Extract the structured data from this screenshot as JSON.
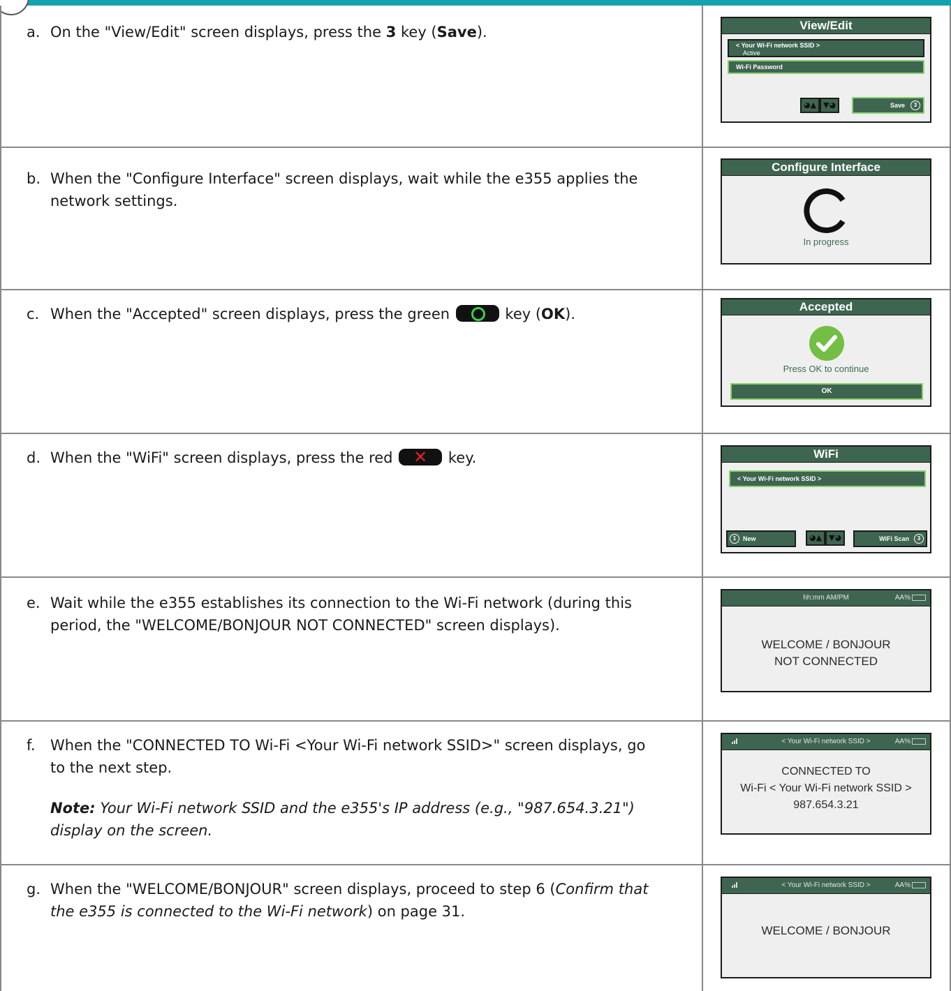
{
  "steps": [
    {
      "letter": "a.",
      "text_pre": "On the \"View/Edit\" screen displays, press the ",
      "key": "3",
      "text_mid": " key (",
      "key_label": "Save",
      "text_post": ")."
    },
    {
      "letter": "b.",
      "text": "When the \"Configure Interface\" screen displays, wait while the e355 applies the network settings."
    },
    {
      "letter": "c.",
      "text_pre": "When the \"Accepted\" screen displays, press the green ",
      "text_mid": " key (",
      "key_label": "OK",
      "text_post": ")."
    },
    {
      "letter": "d.",
      "text_pre": "When the \"WiFi\" screen displays, press the red ",
      "text_post": " key."
    },
    {
      "letter": "e.",
      "text": "Wait while the e355 establishes its connection to the Wi-Fi network (during this period, the \"WELCOME/BONJOUR NOT CONNECTED\" screen displays)."
    },
    {
      "letter": "f.",
      "text": "When the \"CONNECTED TO Wi-Fi <Your Wi-Fi network SSID>\" screen displays, go to the next step.",
      "note_label": "Note:",
      "note_text": " Your Wi-Fi network SSID and the e355's IP address (e.g., \"987.654.3.21\") display on the screen."
    },
    {
      "letter": "g.",
      "text_pre": "When the \"WELCOME/BONJOUR\" screen displays, proceed to step 6 (",
      "italic": "Confirm that the e355 is connected to the Wi-Fi network",
      "text_post": ") on page 31."
    }
  ],
  "screens": {
    "view_edit": {
      "title": "View/Edit",
      "ssid": "< Your Wi-Fi network SSID >",
      "status": "Active",
      "password": "Wi-Fi Password",
      "save": "Save",
      "save_key": "3"
    },
    "configure": {
      "title": "Configure Interface",
      "progress": "In progress"
    },
    "accepted": {
      "title": "Accepted",
      "message": "Press OK to continue",
      "ok": "OK"
    },
    "wifi": {
      "title": "WiFi",
      "ssid": "< Your Wi-Fi network SSID >",
      "new": "New",
      "new_key": "1",
      "scan": "WiFi Scan",
      "scan_key": "3"
    },
    "not_connected": {
      "time": "hh:mm AM/PM",
      "battery": "AA%",
      "line1": "WELCOME / BONJOUR",
      "line2": "NOT CONNECTED"
    },
    "connected": {
      "header": "< Your Wi-Fi network SSID >",
      "battery": "AA%",
      "line1": "CONNECTED TO",
      "line2": "Wi-Fi < Your Wi-Fi network SSID >",
      "line3": "987.654.3.21"
    },
    "welcome": {
      "header": "< Your Wi-Fi network SSID >",
      "battery": "AA%",
      "line1": "WELCOME / BONJOUR"
    }
  }
}
